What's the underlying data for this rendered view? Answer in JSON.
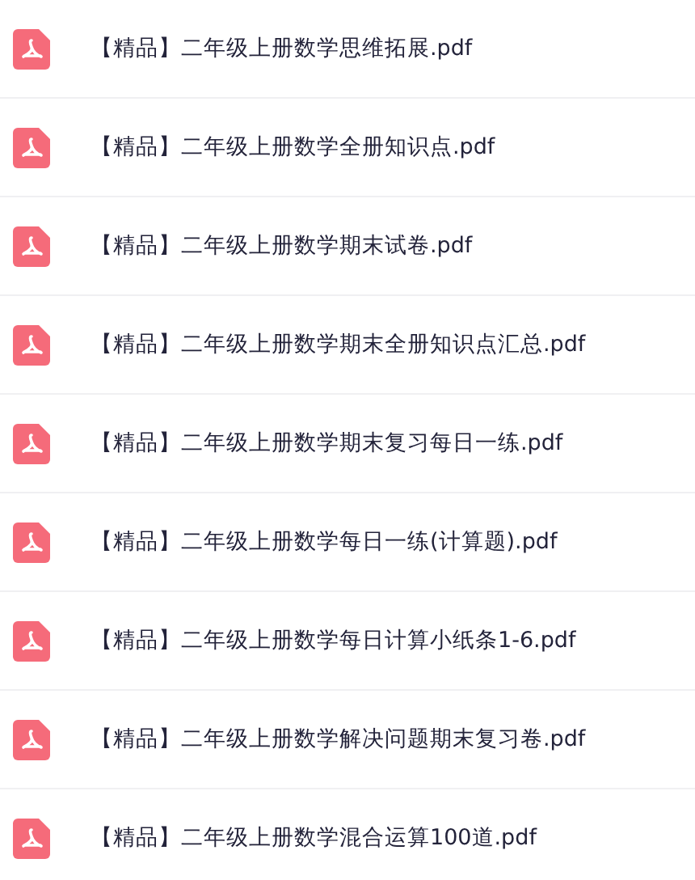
{
  "files": [
    {
      "name": "【精品】二年级上册数学思维拓展.pdf"
    },
    {
      "name": "【精品】二年级上册数学全册知识点.pdf"
    },
    {
      "name": "【精品】二年级上册数学期末试卷.pdf"
    },
    {
      "name": "【精品】二年级上册数学期末全册知识点汇总.pdf"
    },
    {
      "name": "【精品】二年级上册数学期末复习每日一练.pdf"
    },
    {
      "name": "【精品】二年级上册数学每日一练(计算题).pdf"
    },
    {
      "name": "【精品】二年级上册数学每日计算小纸条1-6.pdf"
    },
    {
      "name": "【精品】二年级上册数学解决问题期末复习卷.pdf"
    },
    {
      "name": "【精品】二年级上册数学混合运算100道.pdf"
    }
  ]
}
